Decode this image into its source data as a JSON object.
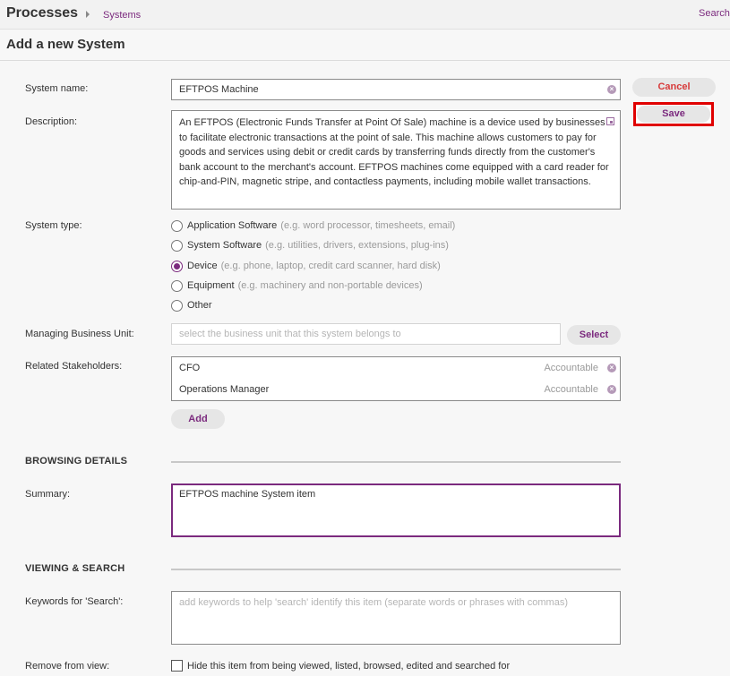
{
  "header": {
    "app_title": "Processes",
    "breadcrumb": "Systems",
    "search_label": "Search"
  },
  "page": {
    "title": "Add a new System"
  },
  "actions": {
    "cancel_label": "Cancel",
    "save_label": "Save"
  },
  "form": {
    "system_name": {
      "label": "System name:",
      "value": "EFTPOS Machine"
    },
    "description": {
      "label": "Description:",
      "value": "An EFTPOS (Electronic Funds Transfer at Point Of Sale) machine is a device used by businesses to facilitate electronic transactions at the point of sale. This machine allows customers to pay for goods and services using debit or credit cards by transferring funds directly from the customer's bank account to the merchant's account. EFTPOS machines come equipped with a card reader for chip-and-PIN, magnetic stripe, and contactless payments, including mobile wallet transactions."
    },
    "system_type": {
      "label": "System type:",
      "selected": "Device",
      "options": [
        {
          "label": "Application Software",
          "hint": "(e.g. word processor, timesheets, email)"
        },
        {
          "label": "System Software",
          "hint": "(e.g. utilities, drivers, extensions, plug-ins)"
        },
        {
          "label": "Device",
          "hint": "(e.g. phone, laptop, credit card scanner, hard disk)"
        },
        {
          "label": "Equipment",
          "hint": "(e.g. machinery and non-portable devices)"
        },
        {
          "label": "Other",
          "hint": ""
        }
      ]
    },
    "business_unit": {
      "label": "Managing Business Unit:",
      "placeholder": "select the business unit that this system belongs to",
      "select_label": "Select"
    },
    "stakeholders": {
      "label": "Related Stakeholders:",
      "items": [
        {
          "name": "CFO",
          "role": "Accountable"
        },
        {
          "name": "Operations Manager",
          "role": "Accountable"
        }
      ],
      "add_label": "Add"
    },
    "browsing": {
      "heading": "BROWSING DETAILS",
      "summary_label": "Summary:",
      "summary_value": "EFTPOS machine System item"
    },
    "viewing": {
      "heading": "VIEWING & SEARCH",
      "keywords_label": "Keywords for 'Search':",
      "keywords_placeholder": "add keywords to help 'search' identify this item (separate words or phrases with commas)",
      "remove_label": "Remove from view:",
      "remove_checkbox_label": "Hide this item from being viewed, listed, browsed, edited and searched for",
      "remove_checked": false
    }
  },
  "colors": {
    "accent": "#7b2a7e",
    "danger": "#d73a3a",
    "highlight_frame": "#e00000"
  }
}
